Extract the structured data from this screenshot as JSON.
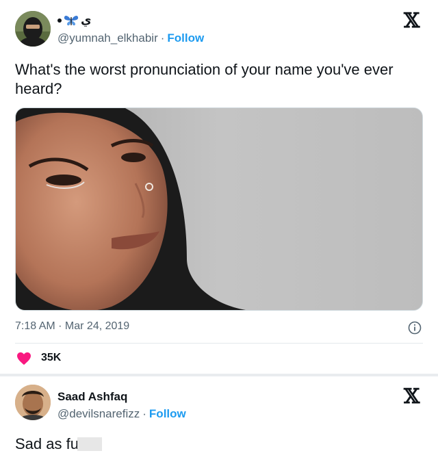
{
  "tweet": {
    "author_display": "ي",
    "handle": "@yumnah_elkhabir",
    "separator": "·",
    "follow_label": "Follow",
    "text": "What's the worst pronunciation of your name you've ever heard?",
    "timestamp": "7:18 AM · Mar 24, 2019",
    "likes": "35K",
    "icons": {
      "platform": "x-logo-icon",
      "butterfly": "butterfly-icon",
      "info": "info-icon",
      "like": "heart-icon"
    },
    "colors": {
      "follow": "#1d9bf0",
      "heart": "#f91880"
    }
  },
  "reply": {
    "author_name": "Saad Ashfaq",
    "handle": "@devilsnarefizz",
    "separator": "·",
    "follow_label": "Follow",
    "text": "Sad as fu",
    "icons": {
      "platform": "x-logo-icon"
    }
  }
}
